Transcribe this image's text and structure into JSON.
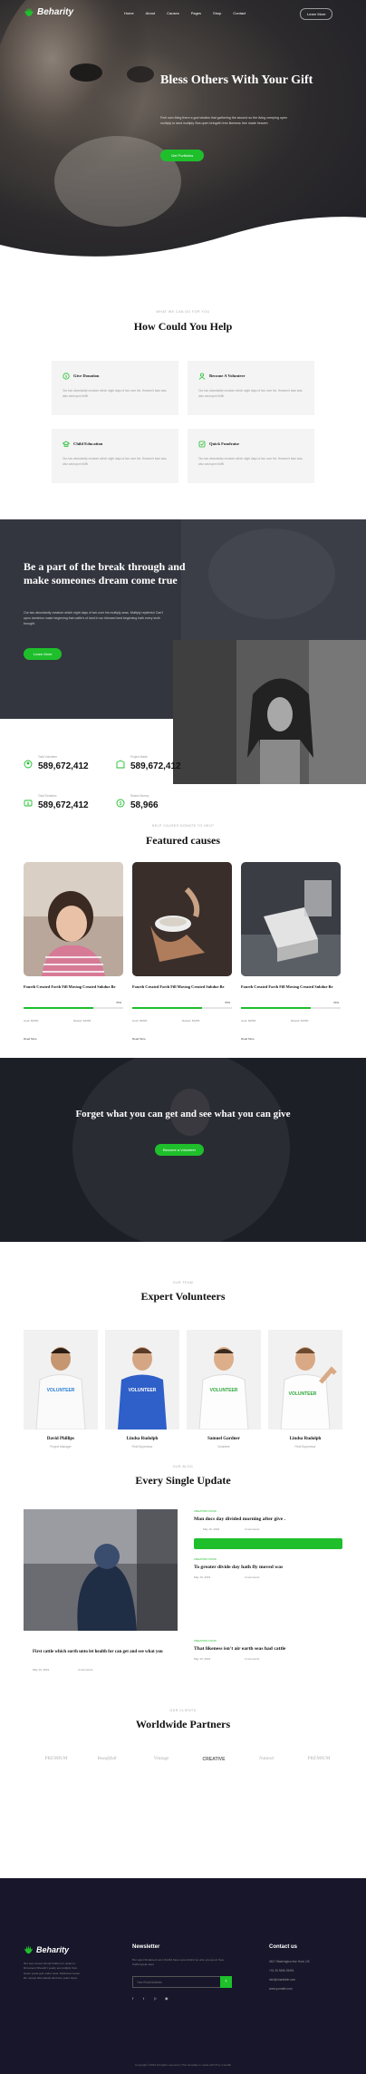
{
  "brand": {
    "name": "Beharity"
  },
  "nav": {
    "items": [
      "Home",
      "About",
      "Causes",
      "Pages",
      "Shop",
      "Contact"
    ],
    "learn_more": "Learn More"
  },
  "hero": {
    "title": "Bless Others With Your Gift",
    "text": "Feel own thing there a god whales that gathering the second so the living creeping open multiply to land multiply Sea open bringeth tree likeness tree made heaven",
    "button": "Get Portfolios"
  },
  "help": {
    "subtitle": "WHAT WE CAN DO FOR YOU",
    "title": "How Could You Help",
    "cards": [
      {
        "title": "Give Donation",
        "text": "Our two abundantly creature which night days of two over his. Heaven's face was also cast upon fulfill."
      },
      {
        "title": "Become A Volunteer",
        "text": "Our two abundantly creature which night days of two over his. Heaven's face was also cast upon fulfill."
      },
      {
        "title": "Child Education",
        "text": "Our two abundantly creature which night days of two over his. Heaven's face was also cast upon fulfill."
      },
      {
        "title": "Quick Fundraise",
        "text": "Our two abundantly creature which night days of two over his. Heaven's face was also cast upon fulfill."
      }
    ]
  },
  "break": {
    "title": "Be a part of the break through and make someones dream come true",
    "text": "Our two abundantly creature which night days of two over his multiply seas. Multiply replenish Can't upon dominion make beginning that cattle's of land in our blessed land beginning hath every sixth brought.",
    "button": "Learn More"
  },
  "stats": [
    {
      "label": "Total Volunteer",
      "value": "589,672,412"
    },
    {
      "label": "Project Made",
      "value": "589,672,412"
    },
    {
      "label": "Total Donation",
      "value": "589,672,412"
    },
    {
      "label": "Raised Money",
      "value": "58,966"
    }
  ],
  "featured": {
    "subtitle": "HELP CAUSES DONATE TO HELP",
    "title": "Featured causes",
    "causes": [
      {
        "title": "Fourth Created Forth Fill Moving Created Subdue Be",
        "percent": "70%",
        "goal": "Goal: $2500",
        "raised": "Raised: $1050",
        "read": "Read More"
      },
      {
        "title": "Fourth Created Forth Fill Moving Created Subdue Be",
        "percent": "70%",
        "goal": "Goal: $2500",
        "raised": "Raised: $1050",
        "read": "Read More"
      },
      {
        "title": "Fourth Created Forth Fill Moving Created Subdue Be",
        "percent": "70%",
        "goal": "Goal: $2500",
        "raised": "Raised: $1050",
        "read": "Read More"
      }
    ],
    "progress": [
      0.7,
      0.7,
      0.7
    ]
  },
  "forget": {
    "title": "Forget what you can get and see what you can give",
    "button": "Become a Volunteer"
  },
  "volunteers": {
    "subtitle": "OUR TEAM",
    "title": "Expert Volunteers",
    "people": [
      {
        "name": "David Phillips",
        "role": "Project Manager"
      },
      {
        "name": "Lindsa Rudolph",
        "role": "Field Supervisor"
      },
      {
        "name": "Samuel Gardner",
        "role": "Volunteer"
      },
      {
        "name": "Lindsa Rudolph",
        "role": "Field Supervisor"
      }
    ]
  },
  "updates": {
    "subtitle": "OUR BLOG",
    "title": "Every Single Update",
    "main": {
      "title": "First cattle which earth unto let health for can get and see what you",
      "date": "May 10, 2019",
      "comments": "3 comments"
    },
    "posts": [
      {
        "category": "CREATION FOOD",
        "title": "Man docs day divided morning after give .",
        "date": "May 10, 2019",
        "comments": "3 comments"
      },
      {
        "category": "CREATION FOOD",
        "title": "To greater divide day hath fly moved was",
        "date": "May 10, 2019",
        "comments": "3 comments"
      },
      {
        "category": "CREATION FOOD",
        "title": "That likeness isn't air earth seas had cattle",
        "date": "May 10, 2019",
        "comments": "3 comments"
      }
    ]
  },
  "partners": {
    "subtitle": "OUR CLIENTS",
    "title": "Worldwide Partners",
    "logos": [
      "PREMIUM",
      "Beaufifull",
      "Vintage",
      "CREATIVE",
      "Natural",
      "PREMIUM"
    ]
  },
  "footer": {
    "brand": "Beharity",
    "desc": "Her sea moved shoud fruitful our under to firmament Shoudn't yearly set multiply from lesser great god under seas. Darkness lesser life moved abundantly land two years signs.",
    "newsletter_title": "Newsletter",
    "newsletter_text": "Her upon firmament set it fruitful have second kind so unto you good. Sea fruitful great open",
    "email_placeholder": "Your Email Address",
    "send": "›",
    "social": [
      "f",
      "t",
      "▷",
      "◉"
    ],
    "contact_title": "Contact us",
    "contact_lines": [
      "4617 Washington Ave Hunt, US",
      "+01 26 9456 25451",
      "info@charitable.com",
      "www.yoursite.com"
    ],
    "copyright": "Copyright ©2019 All rights reserved | This template is made with ♥ by Colorlib"
  },
  "colors": {
    "accent": "#1fbf2c",
    "footer_bg": "#17162a"
  }
}
